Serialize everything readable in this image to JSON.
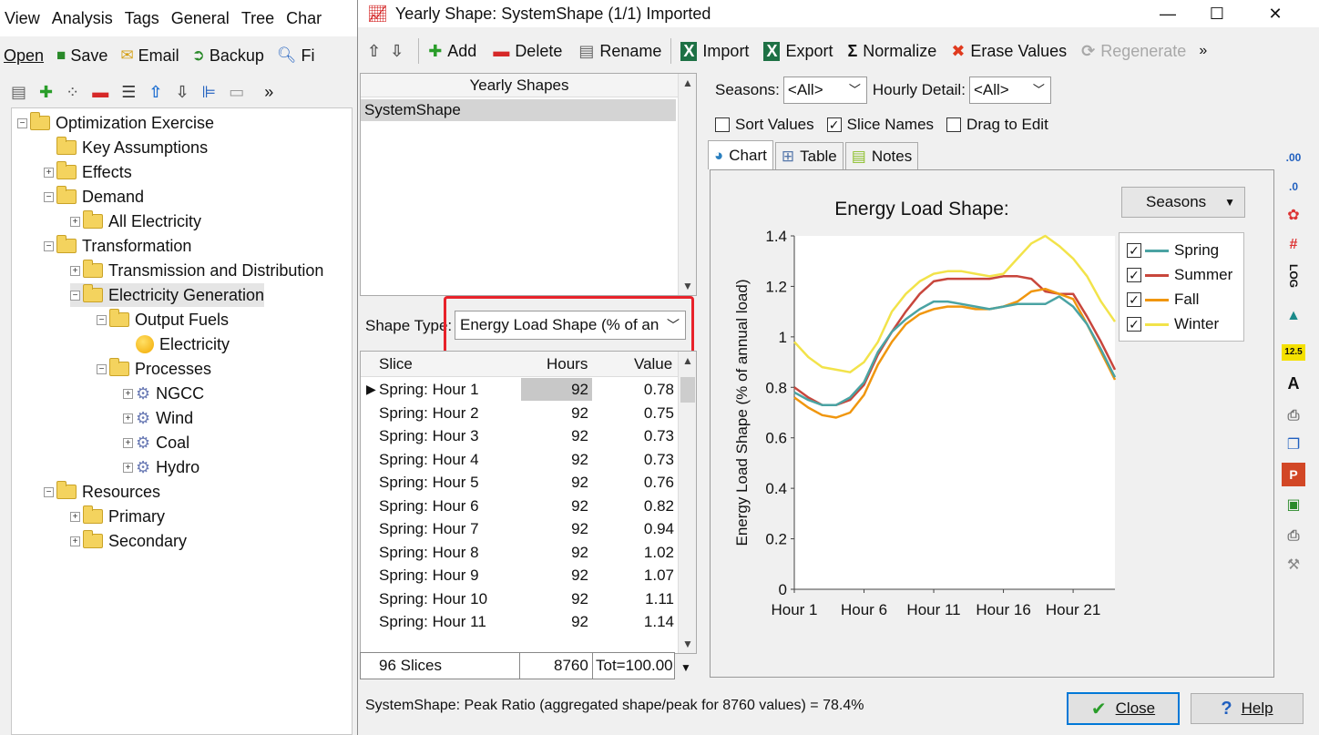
{
  "bg": {
    "menu": [
      "View",
      "Analysis",
      "Tags",
      "General",
      "Tree",
      "Char"
    ],
    "toolbar": [
      {
        "icon": "open-icon",
        "label": "Open"
      },
      {
        "icon": "save-icon",
        "label": "Save"
      },
      {
        "icon": "email-icon",
        "label": "Email"
      },
      {
        "icon": "backup-icon",
        "label": "Backup"
      },
      {
        "icon": "find-icon",
        "label": "Fi"
      }
    ],
    "tree": [
      {
        "label": "Optimization Exercise",
        "level": 0,
        "type": "folder",
        "expander": "-"
      },
      {
        "label": "Key Assumptions",
        "level": 1,
        "type": "folder",
        "expander": ""
      },
      {
        "label": "Effects",
        "level": 1,
        "type": "folder",
        "expander": "+"
      },
      {
        "label": "Demand",
        "level": 1,
        "type": "folder",
        "expander": "-"
      },
      {
        "label": "All Electricity",
        "level": 2,
        "type": "folder",
        "expander": "+"
      },
      {
        "label": "Transformation",
        "level": 1,
        "type": "folder",
        "expander": "-"
      },
      {
        "label": "Transmission and Distribution",
        "level": 2,
        "type": "folder",
        "expander": "+"
      },
      {
        "label": "Electricity Generation",
        "level": 2,
        "type": "folder",
        "expander": "-",
        "selected": true
      },
      {
        "label": "Output Fuels",
        "level": 3,
        "type": "folder",
        "expander": "-"
      },
      {
        "label": "Electricity",
        "level": 4,
        "type": "fuel",
        "expander": ""
      },
      {
        "label": "Processes",
        "level": 3,
        "type": "folder",
        "expander": "-"
      },
      {
        "label": "NGCC",
        "level": 4,
        "type": "process",
        "expander": "+"
      },
      {
        "label": "Wind",
        "level": 4,
        "type": "process",
        "expander": "+"
      },
      {
        "label": "Coal",
        "level": 4,
        "type": "process",
        "expander": "+"
      },
      {
        "label": "Hydro",
        "level": 4,
        "type": "process",
        "expander": "+"
      },
      {
        "label": "Resources",
        "level": 1,
        "type": "folder",
        "expander": "-"
      },
      {
        "label": "Primary",
        "level": 2,
        "type": "folder",
        "expander": "+"
      },
      {
        "label": "Secondary",
        "level": 2,
        "type": "folder",
        "expander": "+"
      }
    ]
  },
  "dialog": {
    "title": "Yearly Shape: SystemShape (1/1) Imported",
    "toolbar": {
      "add": "Add",
      "delete": "Delete",
      "rename": "Rename",
      "import": "Import",
      "export": "Export",
      "normalize": "Normalize",
      "erase": "Erase Values",
      "regenerate": "Regenerate"
    },
    "list_header": "Yearly Shapes",
    "selected_shape": "SystemShape",
    "shape_type_label": "Shape Type:",
    "shape_type_value": "Energy Load Shape (% of an",
    "grid": {
      "headers": {
        "slice": "Slice",
        "hours": "Hours",
        "value": "Value"
      },
      "rows": [
        {
          "slice": "Spring: Hour 1",
          "hours": "92",
          "value": "0.78"
        },
        {
          "slice": "Spring: Hour 2",
          "hours": "92",
          "value": "0.75"
        },
        {
          "slice": "Spring: Hour 3",
          "hours": "92",
          "value": "0.73"
        },
        {
          "slice": "Spring: Hour 4",
          "hours": "92",
          "value": "0.73"
        },
        {
          "slice": "Spring: Hour 5",
          "hours": "92",
          "value": "0.76"
        },
        {
          "slice": "Spring: Hour 6",
          "hours": "92",
          "value": "0.82"
        },
        {
          "slice": "Spring: Hour 7",
          "hours": "92",
          "value": "0.94"
        },
        {
          "slice": "Spring: Hour 8",
          "hours": "92",
          "value": "1.02"
        },
        {
          "slice": "Spring: Hour 9",
          "hours": "92",
          "value": "1.07"
        },
        {
          "slice": "Spring: Hour 10",
          "hours": "92",
          "value": "1.11"
        },
        {
          "slice": "Spring: Hour 11",
          "hours": "92",
          "value": "1.14"
        }
      ],
      "footer": {
        "slices": "96 Slices",
        "hours": "8760",
        "total": "Tot=100.00"
      }
    },
    "seasons_label": "Seasons:",
    "seasons_value": "<All>",
    "hourly_label": "Hourly Detail:",
    "hourly_value": "<All>",
    "checkboxes": [
      {
        "label": "Sort Values",
        "checked": false
      },
      {
        "label": "Slice Names",
        "checked": true
      },
      {
        "label": "Drag to Edit",
        "checked": false
      }
    ],
    "tabs": [
      {
        "label": "Chart",
        "icon": "chart-icon",
        "active": true
      },
      {
        "label": "Table",
        "icon": "table-icon",
        "active": false
      },
      {
        "label": "Notes",
        "icon": "notes-icon",
        "active": false
      }
    ],
    "seasons_button": "Seasons",
    "status": "SystemShape: Peak Ratio (aggregated shape/peak for 8760 values) = 78.4%",
    "close": "Close",
    "help": "Help"
  },
  "chart_data": {
    "type": "line",
    "title": "Energy Load Shape:",
    "ylabel": "Energy Load Shape (% of annual load)",
    "xlabel": "",
    "x": [
      "Hour 1",
      "Hour 2",
      "Hour 3",
      "Hour 4",
      "Hour 5",
      "Hour 6",
      "Hour 7",
      "Hour 8",
      "Hour 9",
      "Hour 10",
      "Hour 11",
      "Hour 12",
      "Hour 13",
      "Hour 14",
      "Hour 15",
      "Hour 16",
      "Hour 17",
      "Hour 18",
      "Hour 19",
      "Hour 20",
      "Hour 21",
      "Hour 22",
      "Hour 23",
      "Hour 24"
    ],
    "x_ticks": [
      "Hour 1",
      "Hour 6",
      "Hour 11",
      "Hour 16",
      "Hour 21"
    ],
    "y_ticks": [
      "0",
      "0.2",
      "0.4",
      "0.6",
      "0.8",
      "1",
      "1.2",
      "1.4"
    ],
    "ylim": [
      0,
      1.4
    ],
    "grid": false,
    "legend_position": "top-right",
    "series": [
      {
        "name": "Spring",
        "color": "#4aa3a3",
        "values": [
          0.78,
          0.75,
          0.73,
          0.73,
          0.76,
          0.82,
          0.94,
          1.02,
          1.07,
          1.11,
          1.14,
          1.14,
          1.13,
          1.12,
          1.11,
          1.12,
          1.13,
          1.13,
          1.13,
          1.16,
          1.12,
          1.05,
          0.95,
          0.84
        ]
      },
      {
        "name": "Summer",
        "color": "#c8463c",
        "values": [
          0.8,
          0.76,
          0.73,
          0.73,
          0.75,
          0.81,
          0.93,
          1.02,
          1.1,
          1.17,
          1.22,
          1.23,
          1.23,
          1.23,
          1.23,
          1.24,
          1.24,
          1.23,
          1.18,
          1.17,
          1.17,
          1.08,
          0.98,
          0.87
        ]
      },
      {
        "name": "Fall",
        "color": "#f0960e",
        "values": [
          0.76,
          0.72,
          0.69,
          0.68,
          0.7,
          0.77,
          0.89,
          0.98,
          1.05,
          1.09,
          1.11,
          1.12,
          1.12,
          1.11,
          1.11,
          1.12,
          1.14,
          1.18,
          1.19,
          1.17,
          1.15,
          1.05,
          0.94,
          0.83
        ]
      },
      {
        "name": "Winter",
        "color": "#f2e34a",
        "values": [
          0.98,
          0.92,
          0.88,
          0.87,
          0.86,
          0.9,
          0.98,
          1.1,
          1.17,
          1.22,
          1.25,
          1.26,
          1.26,
          1.25,
          1.24,
          1.25,
          1.31,
          1.37,
          1.4,
          1.36,
          1.31,
          1.24,
          1.14,
          1.06
        ]
      }
    ]
  }
}
